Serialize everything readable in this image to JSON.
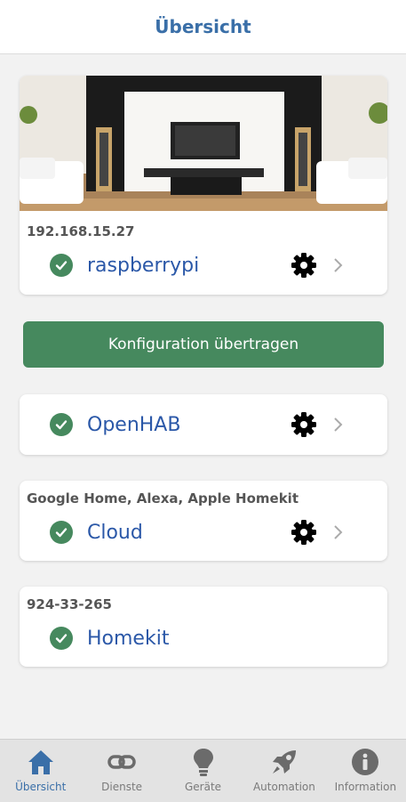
{
  "header": {
    "title": "Übersicht"
  },
  "cards": {
    "raspberry": {
      "ip": "192.168.15.27",
      "name": "raspberrypi"
    },
    "openhab": {
      "name": "OpenHAB"
    },
    "cloud": {
      "subtitle": "Google Home, Alexa, Apple Homekit",
      "name": "Cloud"
    },
    "homekit": {
      "code": "924-33-265",
      "name": "Homekit"
    }
  },
  "button": {
    "label": "Konfiguration übertragen"
  },
  "tabs": [
    {
      "label": "Übersicht",
      "icon": "home-icon",
      "active": true
    },
    {
      "label": "Dienste",
      "icon": "link-icon",
      "active": false
    },
    {
      "label": "Geräte",
      "icon": "lightbulb-icon",
      "active": false
    },
    {
      "label": "Automation",
      "icon": "rocket-icon",
      "active": false
    },
    {
      "label": "Information",
      "icon": "info-icon",
      "active": false
    }
  ],
  "colors": {
    "accent": "#46895e",
    "title": "#3a6fa8",
    "link": "#2b58a8",
    "tabActive": "#3a6fa8",
    "tabInactive": "#7a7a7a"
  }
}
